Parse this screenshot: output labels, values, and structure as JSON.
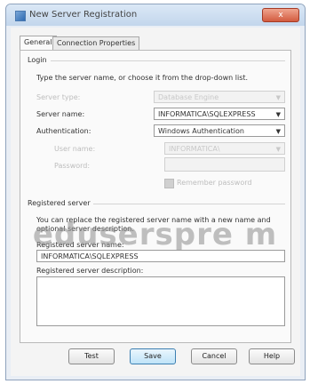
{
  "window": {
    "title": "New Server Registration",
    "close_label": "x"
  },
  "tabs": [
    {
      "label": "General",
      "active": true
    },
    {
      "label": "Connection Properties",
      "active": false
    }
  ],
  "login": {
    "group_label": "Login",
    "instructions": "Type the server name, or choose it from the drop-down list.",
    "server_type": {
      "label": "Server type:",
      "value": "Database Engine",
      "enabled": false
    },
    "server_name": {
      "label": "Server name:",
      "value": "INFORMATICA\\SQLEXPRESS",
      "enabled": true
    },
    "authentication": {
      "label": "Authentication:",
      "value": "Windows Authentication",
      "enabled": true
    },
    "user_name": {
      "label": "User name:",
      "value": "INFORMATICA\\",
      "enabled": false
    },
    "password": {
      "label": "Password:",
      "value": "",
      "enabled": false
    },
    "remember_password": {
      "label": "Remember password",
      "checked": false,
      "enabled": false
    }
  },
  "registered_server": {
    "group_label": "Registered server",
    "description_text": "You can replace the registered server name with a new name and optional server description.",
    "name_label": "Registered server name:",
    "name_value": "INFORMATICA\\SQLEXPRESS",
    "description_label": "Registered server description:",
    "description_value": ""
  },
  "watermark": "eduserspre m",
  "buttons": {
    "test": "Test",
    "save": "Save",
    "cancel": "Cancel",
    "help": "Help"
  }
}
